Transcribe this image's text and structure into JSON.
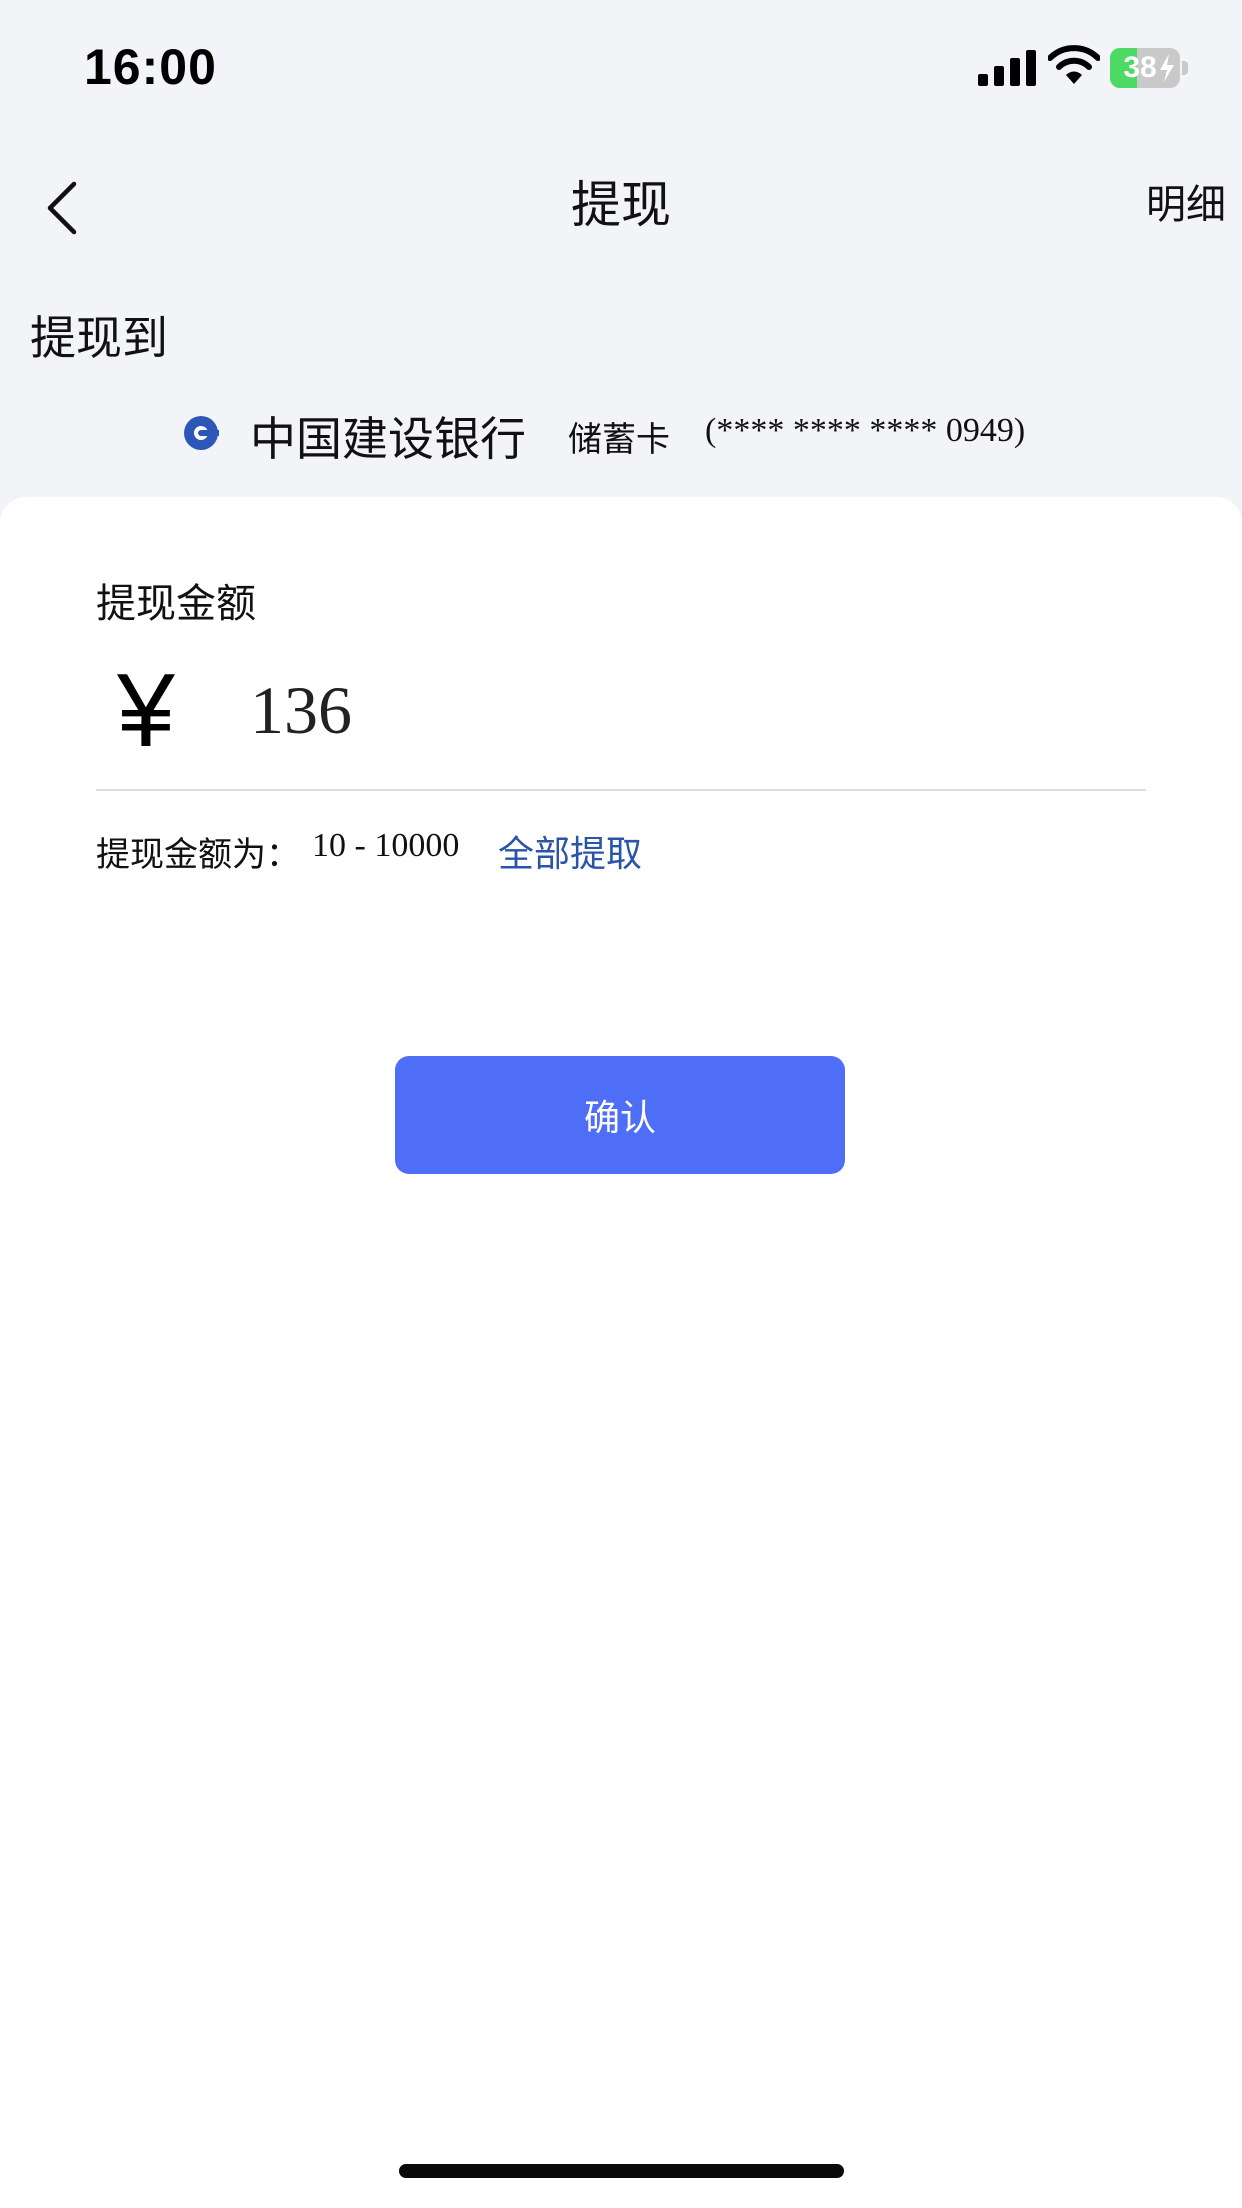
{
  "status_bar": {
    "time": "16:00",
    "battery_level": "38",
    "battery_fraction": 0.38,
    "icons": [
      "signal-bars-icon",
      "wifi-icon",
      "battery-charging-icon"
    ]
  },
  "nav": {
    "back_icon": "chevron-left-icon",
    "title": "提现",
    "detail_label": "明细"
  },
  "withdraw_to": {
    "label": "提现到",
    "bank_icon": "ccb-bank-logo-icon",
    "bank_name": "中国建设银行",
    "card_type": "储蓄卡",
    "card_number": "(**** **** **** 0949)"
  },
  "amount": {
    "label": "提现金额",
    "currency_symbol": "¥",
    "value": "136",
    "range_label": "提现金额为：",
    "range_value": "10 - 10000",
    "withdraw_all_label": "全部提取"
  },
  "confirm_label": "确认",
  "colors": {
    "background": "#f3f4f8",
    "card": "#ffffff",
    "primary_button": "#4f6ef7",
    "link": "#2a54a8",
    "bank_logo": "#2d57b7",
    "battery_fill": "#4cd964"
  }
}
